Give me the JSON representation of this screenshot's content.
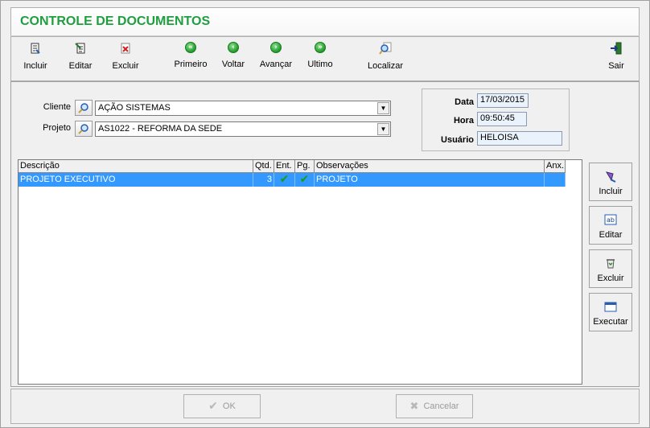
{
  "window": {
    "title": "CONTROLE DE DOCUMENTOS"
  },
  "toolbar": {
    "incluir": "Incluir",
    "editar": "Editar",
    "excluir": "Excluir",
    "primeiro": "Primeiro",
    "voltar": "Voltar",
    "avancar": "Avançar",
    "ultimo": "Ultimo",
    "localizar": "Localizar",
    "sair": "Sair"
  },
  "form": {
    "cliente_label": "Cliente",
    "cliente_value": "AÇÃO SISTEMAS",
    "projeto_label": "Projeto",
    "projeto_value": "AS1022 - REFORMA DA SEDE"
  },
  "info": {
    "data_label": "Data",
    "data_value": "17/03/2015",
    "hora_label": "Hora",
    "hora_value": "09:50:45",
    "usuario_label": "Usuário",
    "usuario_value": "HELOISA"
  },
  "grid": {
    "columns": [
      "Descrição",
      "Qtd.",
      "Ent.",
      "Pg.",
      "Observações",
      "Anx."
    ],
    "rows": [
      {
        "descricao": "PROJETO EXECUTIVO",
        "qtd": "3",
        "ent": true,
        "pg": true,
        "observacoes": "PROJETO",
        "anx": ""
      }
    ]
  },
  "side": {
    "incluir": "Incluir",
    "editar": "Editar",
    "excluir": "Excluir",
    "executar": "Executar"
  },
  "bottom": {
    "ok": "OK",
    "cancelar": "Cancelar"
  },
  "colors": {
    "title": "#1f9e3f",
    "selection": "#3399ff",
    "check": "#1a9a1a"
  }
}
